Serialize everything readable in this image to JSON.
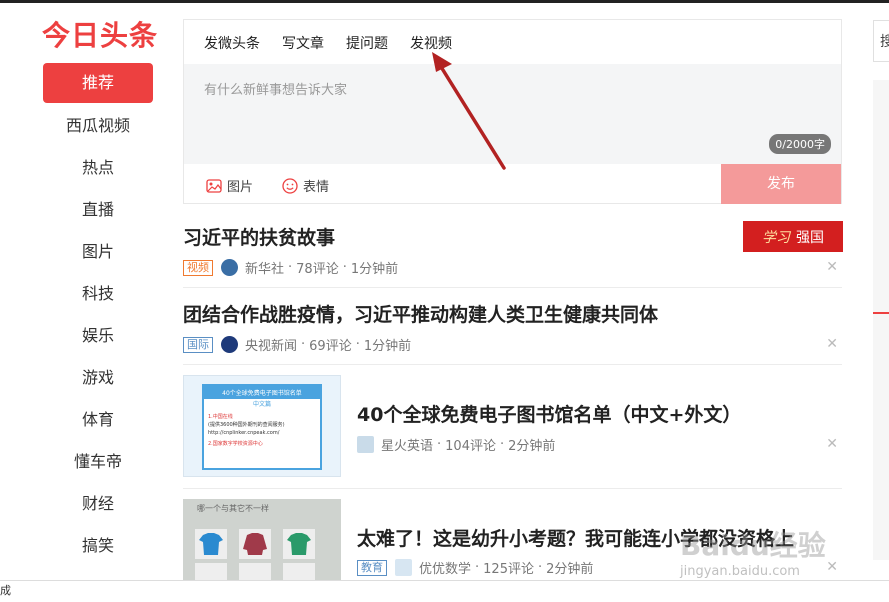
{
  "brand": {
    "logo_text": "今日头条",
    "accent": "#ed4040"
  },
  "sidebar": {
    "items": [
      {
        "label": "推荐",
        "active": true
      },
      {
        "label": "西瓜视频"
      },
      {
        "label": "热点"
      },
      {
        "label": "直播"
      },
      {
        "label": "图片"
      },
      {
        "label": "科技"
      },
      {
        "label": "娱乐"
      },
      {
        "label": "游戏"
      },
      {
        "label": "体育"
      },
      {
        "label": "懂车帝"
      },
      {
        "label": "财经"
      },
      {
        "label": "搞笑"
      }
    ]
  },
  "composer": {
    "tabs": [
      "发微头条",
      "写文章",
      "提问题",
      "发视频"
    ],
    "placeholder": "有什么新鲜事想告诉大家",
    "counter": "0/2000字",
    "tool_image": "图片",
    "tool_emoji": "表情",
    "publish_label": "发布"
  },
  "ad_badge": "强国",
  "feed": [
    {
      "title": "习近平的扶贫故事",
      "tag": "视频",
      "source": "新华社",
      "comments": "78评论",
      "time": "1分钟前",
      "tag_color": "#f07a30"
    },
    {
      "title": "团结合作战胜疫情，习近平推动构建人类卫生健康共同体",
      "tag": "国际",
      "source": "央视新闻",
      "comments": "69评论",
      "time": "1分钟前",
      "tag_color": "#5a8fc4"
    },
    {
      "title": "40个全球免费电子图书馆名单（中文+外文）",
      "source": "星火英语",
      "comments": "104评论",
      "time": "2分钟前"
    },
    {
      "title": "太难了！这是幼升小考题？我可能连小学都没资格上",
      "tag": "教育",
      "source": "优优数学",
      "comments": "125评论",
      "time": "2分钟前",
      "tag_color": "#5a8fc4"
    }
  ],
  "thumb1": {
    "header": "40个全球免费电子图书馆名单",
    "sub": "中文篇",
    "line1": "1.中国在线",
    "line1b": "(提供3600种国外期刊的查阅服务)",
    "line2": "http://cnplinker.cnpeak.com/",
    "line3": "2.国家数字学校资源中心"
  },
  "thumb2": {
    "caption": "哪一个与其它不一样"
  },
  "separator": "·",
  "right_panel_text": "搜",
  "status_text": "成",
  "watermark": {
    "main": "Baidu经验",
    "sub": "jingyan.baidu.com"
  }
}
